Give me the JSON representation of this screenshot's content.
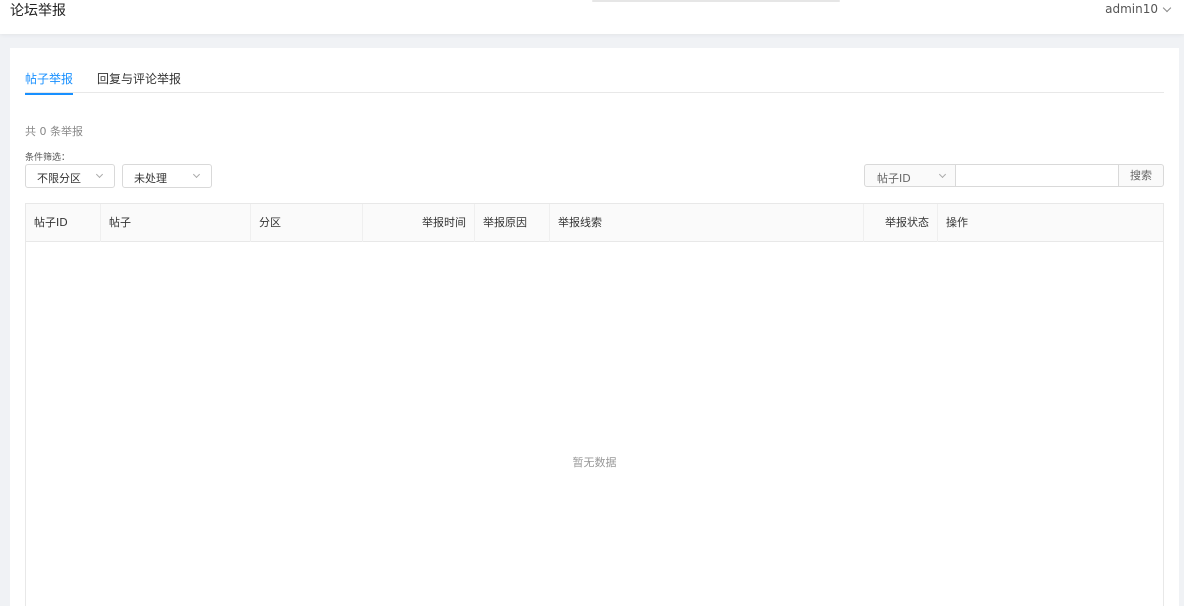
{
  "header": {
    "title": "论坛举报",
    "user": "admin10"
  },
  "tabs": [
    {
      "label": "帖子举报",
      "active": true
    },
    {
      "label": "回复与评论举报",
      "active": false
    }
  ],
  "summary": {
    "total_text": "共 0 条举报",
    "filter_label": "条件筛选："
  },
  "filters": {
    "section": "不限分区",
    "status": "未处理"
  },
  "search": {
    "field": "帖子ID",
    "value": "",
    "button": "搜索"
  },
  "table": {
    "columns": [
      "帖子ID",
      "帖子",
      "分区",
      "举报时间",
      "举报原因",
      "举报线索",
      "举报状态",
      "操作"
    ],
    "rows": [],
    "empty_text": "暂无数据"
  },
  "colors": {
    "accent": "#1890ff",
    "border": "#e8e8e8",
    "header_bg": "#fafafa"
  }
}
